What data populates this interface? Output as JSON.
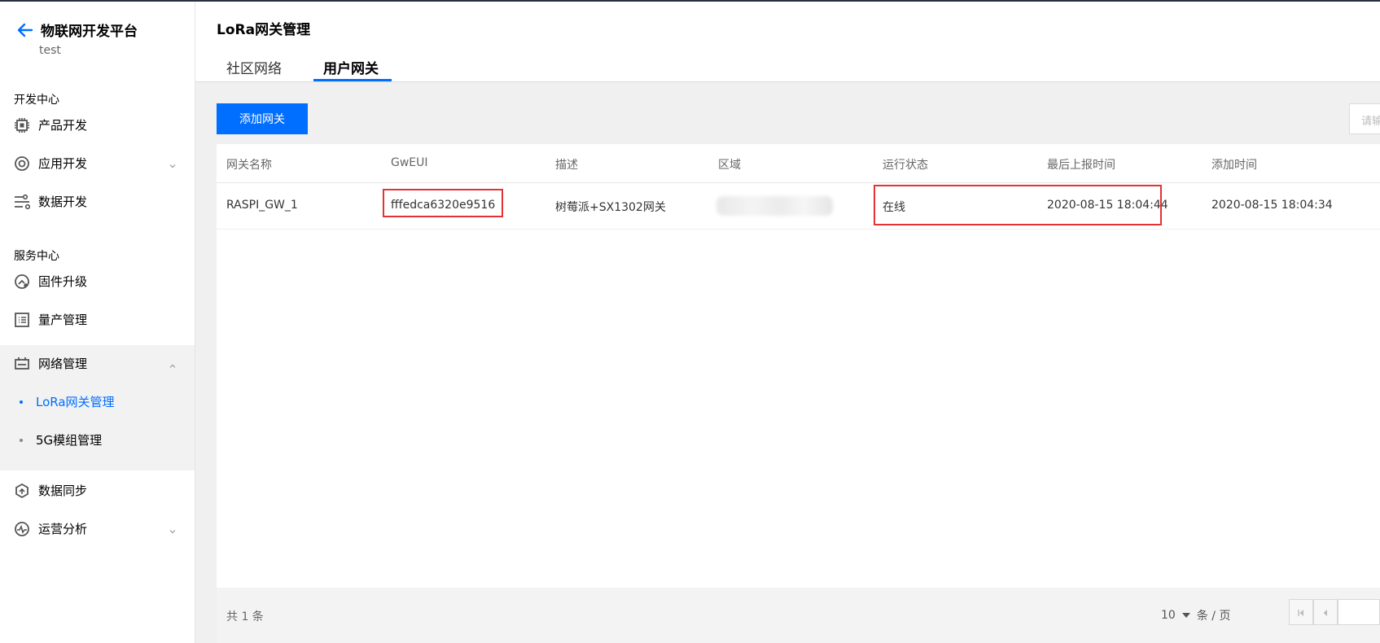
{
  "sidebar": {
    "platform_title": "物联网开发平台",
    "project_name": "test",
    "section_dev": "开发中心",
    "section_service": "服务中心",
    "items": [
      {
        "label": "产品开发",
        "icon": "chip-icon"
      },
      {
        "label": "应用开发",
        "icon": "app-icon"
      },
      {
        "label": "数据开发",
        "icon": "data-flow-icon"
      },
      {
        "label": "固件升级",
        "icon": "firmware-icon"
      },
      {
        "label": "量产管理",
        "icon": "list-icon"
      },
      {
        "label": "网络管理",
        "icon": "network-icon"
      },
      {
        "label": "数据同步",
        "icon": "sync-icon"
      },
      {
        "label": "运营分析",
        "icon": "analytics-icon"
      }
    ],
    "sub_items": [
      {
        "label": "LoRa网关管理"
      },
      {
        "label": "5G模组管理"
      }
    ]
  },
  "header": {
    "title": "LoRa网关管理",
    "tabs": [
      {
        "label": "社区网络"
      },
      {
        "label": "用户网关"
      }
    ]
  },
  "toolbar": {
    "add_button": "添加网关",
    "search_placeholder": "请输"
  },
  "table": {
    "columns": [
      "网关名称",
      "GwEUI",
      "描述",
      "区域",
      "运行状态",
      "最后上报时间",
      "添加时间"
    ],
    "rows": [
      {
        "name": "RASPI_GW_1",
        "gweui": "fffedca6320e9516",
        "description": "树莓派+SX1302网关",
        "status": "在线",
        "last_report": "2020-08-15 18:04:44",
        "added": "2020-08-15 18:04:34"
      }
    ]
  },
  "footer": {
    "total": "共  1  条",
    "page_size": "10",
    "page_size_unit": "条 / 页"
  },
  "colors": {
    "accent": "#006eff",
    "highlight": "#e63232"
  }
}
